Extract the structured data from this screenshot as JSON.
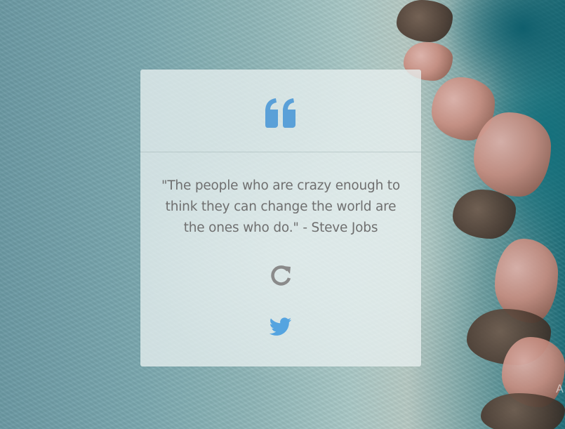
{
  "quote": {
    "text": "\"The people who are crazy enough to think they can change the world are the ones who do.\" - Steve Jobs"
  },
  "icons": {
    "quote_mark": "quote-left-icon",
    "refresh": "refresh-icon",
    "tweet": "twitter-icon"
  },
  "colors": {
    "accent_blue": "#5aa0d8",
    "twitter_blue": "#55a4e0",
    "refresh_gray": "#8a8a8a",
    "quote_text": "#6f6f6f",
    "card_bg": "rgba(232,240,240,0.78)"
  },
  "edge_text": "A"
}
